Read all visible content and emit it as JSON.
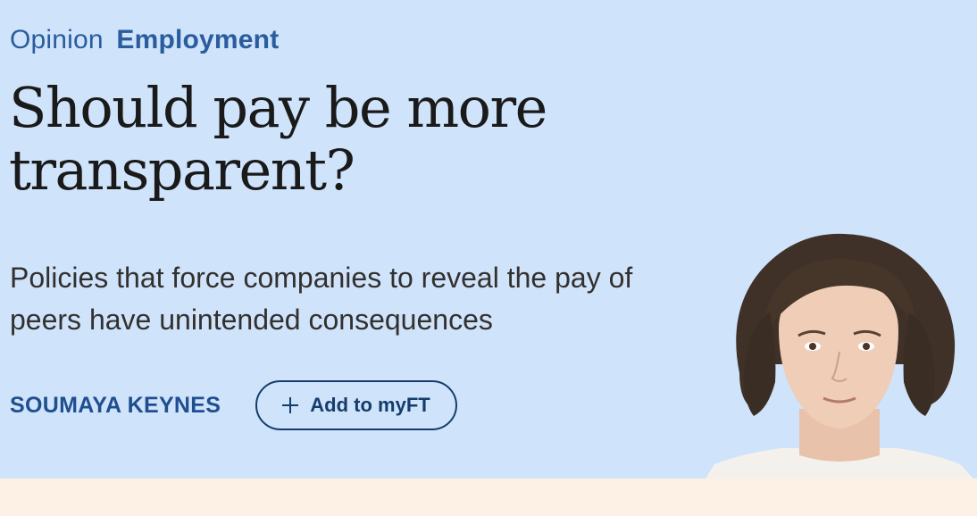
{
  "article": {
    "section": "Opinion",
    "topic": "Employment",
    "headline_line1": "Should pay be more",
    "headline_line2": "transparent?",
    "standfirst": "Policies that force companies to reveal the pay of peers have unintended consequences",
    "author": "SOUMAYA KEYNES",
    "follow_button_label": "Add to myFT"
  },
  "colors": {
    "hero_background": "#cfe3fb",
    "page_background": "#fdf1e6",
    "accent": "#1f4f8f"
  },
  "icons": {
    "follow": "plus-icon",
    "author": "author-photo"
  }
}
